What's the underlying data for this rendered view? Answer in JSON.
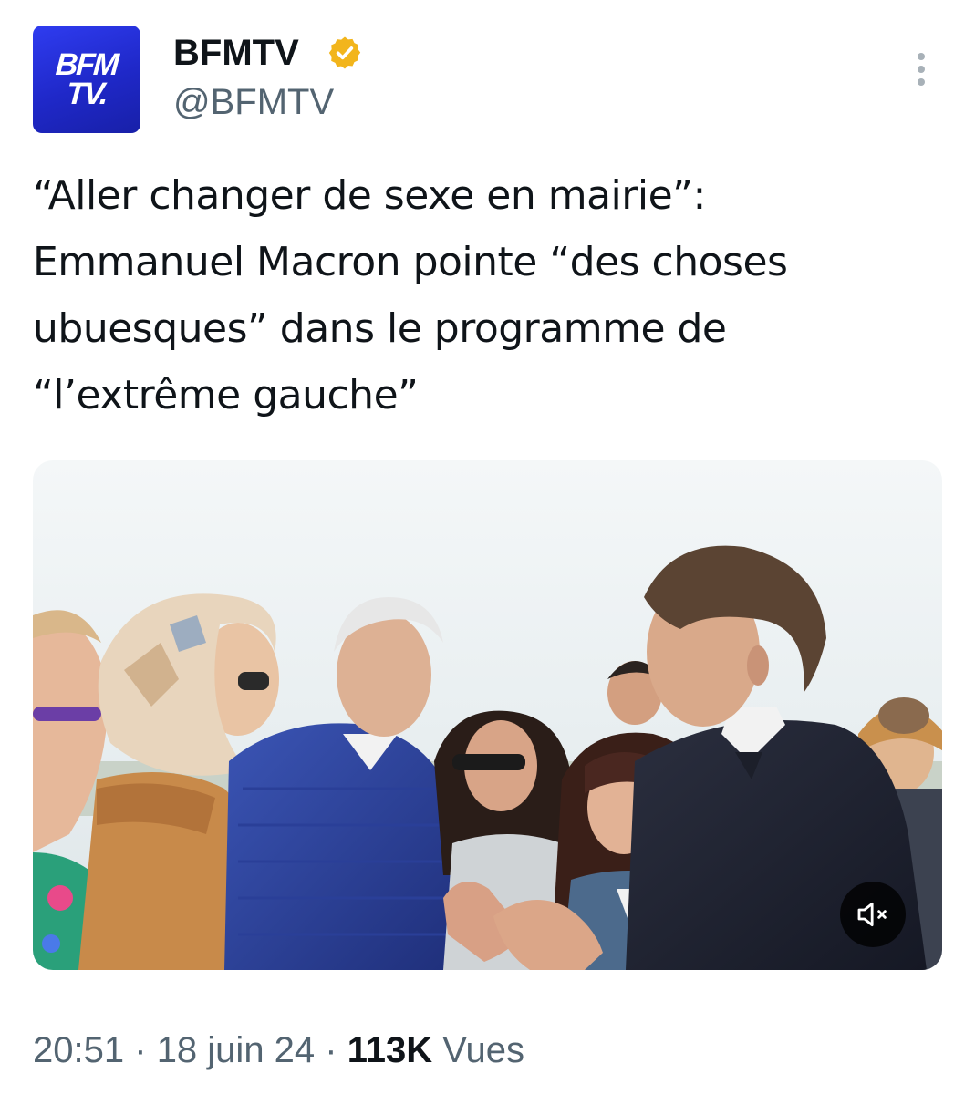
{
  "account": {
    "display_name": "BFMTV",
    "handle": "@BFMTV",
    "avatar_logo": [
      "BFM",
      "TV."
    ],
    "verified": true,
    "verified_color": "#f2b51c"
  },
  "tweet": {
    "text": "“Aller changer de sexe en mairie”:\nEmmanuel Macron pointe “des choses\nubuesques” dans le programme de\n“l’extrême gauche”"
  },
  "media": {
    "type": "video",
    "muted": true
  },
  "meta": {
    "time": "20:51",
    "separator": "·",
    "date": "18 juin 24",
    "views_count": "113K",
    "views_label": "Vues"
  },
  "colors": {
    "brand_blue": "#2a34e0",
    "text_primary": "#0f1419",
    "text_secondary": "#536471"
  },
  "icons": [
    "verified-badge-icon",
    "more-options-icon",
    "volume-muted-icon"
  ]
}
